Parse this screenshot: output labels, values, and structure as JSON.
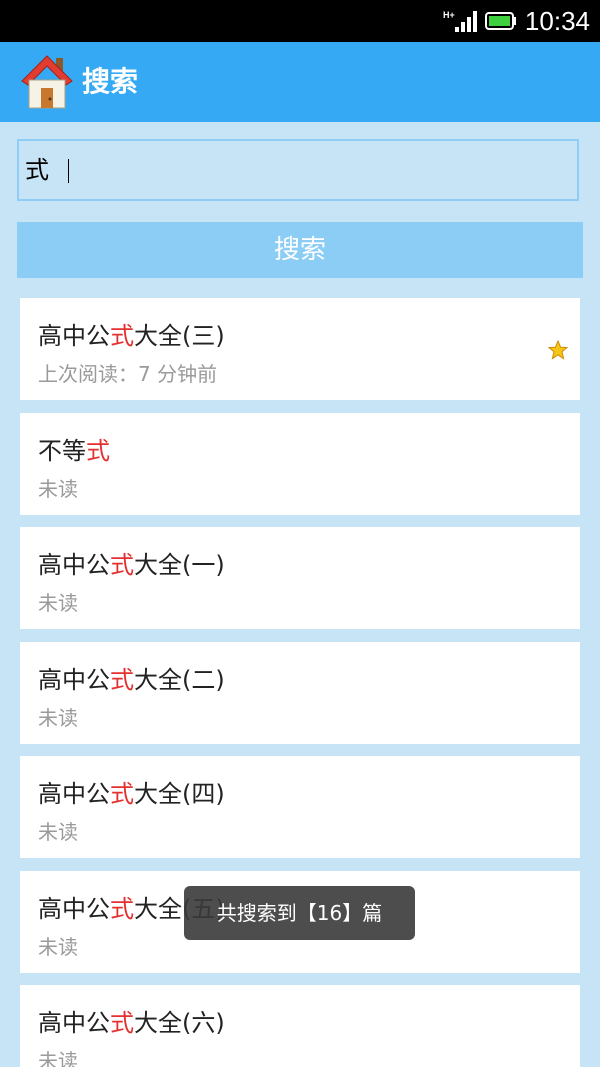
{
  "status_bar": {
    "network": "H+",
    "time": "10:34"
  },
  "header": {
    "title": "搜索"
  },
  "search": {
    "query": "式",
    "button_label": "搜索"
  },
  "results": [
    {
      "prefix": "高中公",
      "highlight": "式",
      "suffix": "大全(三)",
      "status": "上次阅读：7 分钟前",
      "starred": true
    },
    {
      "prefix": "不等",
      "highlight": "式",
      "suffix": "",
      "status": "未读",
      "starred": false
    },
    {
      "prefix": "高中公",
      "highlight": "式",
      "suffix": "大全(一)",
      "status": "未读",
      "starred": false
    },
    {
      "prefix": "高中公",
      "highlight": "式",
      "suffix": "大全(二)",
      "status": "未读",
      "starred": false
    },
    {
      "prefix": "高中公",
      "highlight": "式",
      "suffix": "大全(四)",
      "status": "未读",
      "starred": false
    },
    {
      "prefix": "高中公",
      "highlight": "式",
      "suffix": "大全(五)",
      "status": "未读",
      "starred": false
    },
    {
      "prefix": "高中公",
      "highlight": "式",
      "suffix": "大全(六)",
      "status": "未读",
      "starred": false
    }
  ],
  "toast": {
    "message": "共搜索到【16】篇"
  },
  "colors": {
    "header": "#36a9f4",
    "background": "#c7e3f6",
    "highlight": "#e53030",
    "button": "#8ccdf6"
  }
}
